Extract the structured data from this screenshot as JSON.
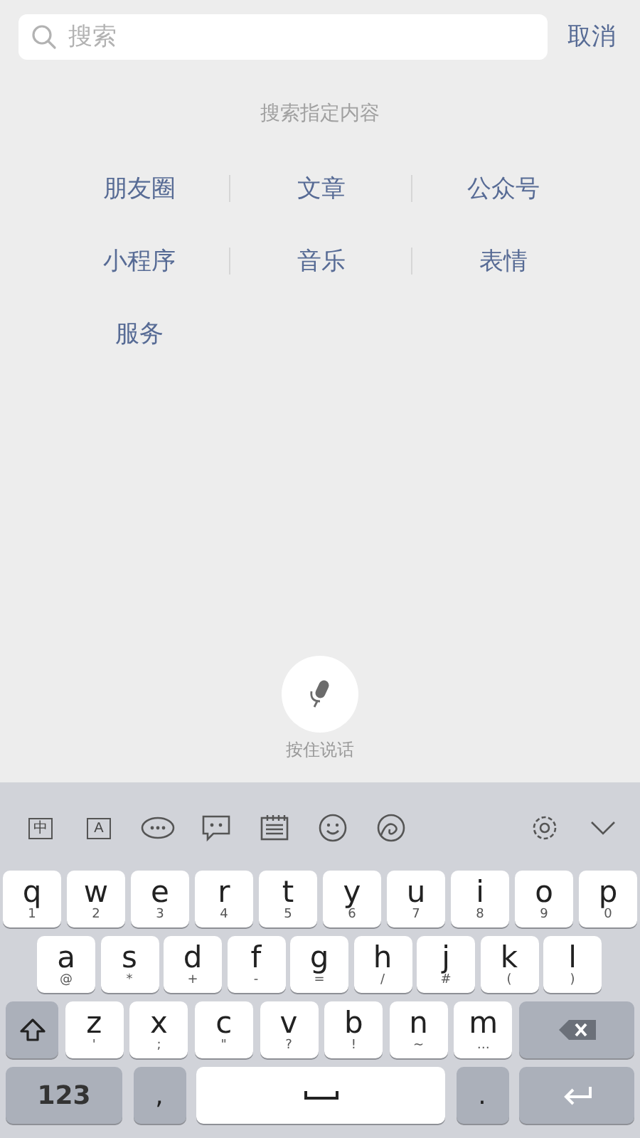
{
  "search": {
    "placeholder": "搜索",
    "cancel": "取消"
  },
  "hint": "搜索指定内容",
  "categories": [
    "朋友圈",
    "文章",
    "公众号",
    "小程序",
    "音乐",
    "表情",
    "服务"
  ],
  "voice": {
    "label": "按住说话"
  },
  "toolbar": [
    {
      "kind": "zh",
      "glyph": "中"
    },
    {
      "kind": "en",
      "glyph": "A"
    },
    {
      "kind": "more"
    },
    {
      "kind": "chat"
    },
    {
      "kind": "notes"
    },
    {
      "kind": "emoji"
    },
    {
      "kind": "swipe"
    },
    {
      "kind": "settings"
    },
    {
      "kind": "collapse"
    }
  ],
  "rows": [
    {
      "keys": [
        {
          "kind": "letter",
          "main": "q",
          "sub": "1"
        },
        {
          "kind": "letter",
          "main": "w",
          "sub": "2"
        },
        {
          "kind": "letter",
          "main": "e",
          "sub": "3"
        },
        {
          "kind": "letter",
          "main": "r",
          "sub": "4"
        },
        {
          "kind": "letter",
          "main": "t",
          "sub": "5"
        },
        {
          "kind": "letter",
          "main": "y",
          "sub": "6"
        },
        {
          "kind": "letter",
          "main": "u",
          "sub": "7"
        },
        {
          "kind": "letter",
          "main": "i",
          "sub": "8"
        },
        {
          "kind": "letter",
          "main": "o",
          "sub": "9"
        },
        {
          "kind": "letter",
          "main": "p",
          "sub": "0"
        }
      ]
    },
    {
      "keys": [
        {
          "kind": "letter",
          "main": "a",
          "sub": "@"
        },
        {
          "kind": "letter",
          "main": "s",
          "sub": "*"
        },
        {
          "kind": "letter",
          "main": "d",
          "sub": "+"
        },
        {
          "kind": "letter",
          "main": "f",
          "sub": "-"
        },
        {
          "kind": "letter",
          "main": "g",
          "sub": "="
        },
        {
          "kind": "letter",
          "main": "h",
          "sub": "/"
        },
        {
          "kind": "letter",
          "main": "j",
          "sub": "#"
        },
        {
          "kind": "letter",
          "main": "k",
          "sub": "("
        },
        {
          "kind": "letter",
          "main": "l",
          "sub": ")"
        }
      ]
    },
    {
      "keys": [
        {
          "kind": "shift"
        },
        {
          "kind": "letter",
          "main": "z",
          "sub": "'"
        },
        {
          "kind": "letter",
          "main": "x",
          "sub": ";"
        },
        {
          "kind": "letter",
          "main": "c",
          "sub": "\""
        },
        {
          "kind": "letter",
          "main": "v",
          "sub": "?"
        },
        {
          "kind": "letter",
          "main": "b",
          "sub": "!"
        },
        {
          "kind": "letter",
          "main": "n",
          "sub": "~"
        },
        {
          "kind": "letter",
          "main": "m",
          "sub": "…"
        },
        {
          "kind": "delete"
        }
      ]
    },
    {
      "keys": [
        {
          "kind": "numbers",
          "main": "123"
        },
        {
          "kind": "punct",
          "main": ","
        },
        {
          "kind": "space"
        },
        {
          "kind": "punct",
          "main": "."
        },
        {
          "kind": "return"
        }
      ]
    }
  ]
}
